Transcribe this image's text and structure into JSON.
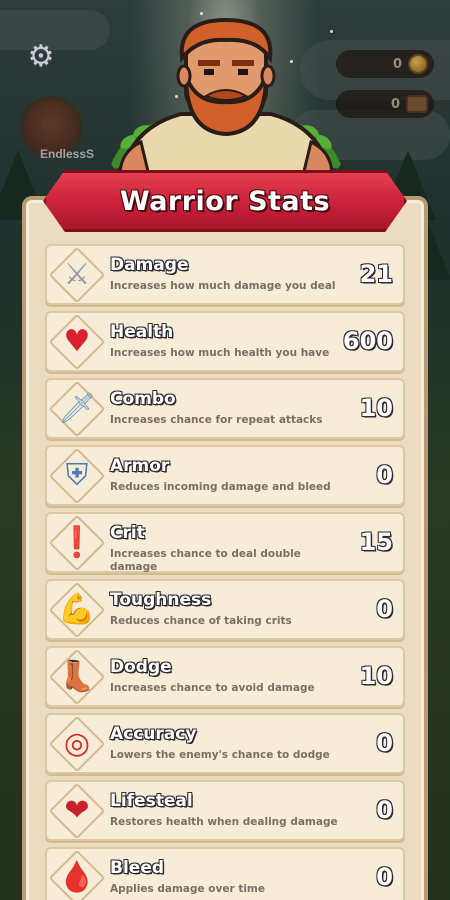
{
  "hud": {
    "player_name": "EndlessS",
    "gold_amount": "0",
    "gems_amount": "0",
    "settings_icon": "gear-icon"
  },
  "panel": {
    "title": "Warrior Stats"
  },
  "stats": [
    {
      "name": "Damage",
      "description": "Increases how much damage you deal",
      "value": "21",
      "icon": "crossed-swords-icon",
      "glyph": "⚔",
      "color": "#8d9aa6"
    },
    {
      "name": "Health",
      "description": "Increases how much health you have",
      "value": "600",
      "icon": "heart-icon",
      "glyph": "♥",
      "color": "#d8202e"
    },
    {
      "name": "Combo",
      "description": "Increases chance for repeat attacks",
      "value": "10",
      "icon": "sword-icon",
      "glyph": "🗡",
      "color": "#6f9cc0"
    },
    {
      "name": "Armor",
      "description": "Reduces incoming damage and bleed",
      "value": "0",
      "icon": "shield-icon",
      "glyph": "⛨",
      "color": "#4a78b8"
    },
    {
      "name": "Crit",
      "description": "Increases chance to deal double damage",
      "value": "15",
      "icon": "exclamation-burst-icon",
      "glyph": "❗",
      "color": "#e0402a"
    },
    {
      "name": "Toughness",
      "description": "Reduces chance of taking crits",
      "value": "0",
      "icon": "flexed-arm-icon",
      "glyph": "💪",
      "color": "#e59a2c"
    },
    {
      "name": "Dodge",
      "description": "Increases chance to avoid damage",
      "value": "10",
      "icon": "boot-icon",
      "glyph": "👢",
      "color": "#b8652e"
    },
    {
      "name": "Accuracy",
      "description": "Lowers the enemy's chance to dodge",
      "value": "0",
      "icon": "target-icon",
      "glyph": "◎",
      "color": "#d62a2a"
    },
    {
      "name": "Lifesteal",
      "description": "Restores health when dealing damage",
      "value": "0",
      "icon": "heart-dagger-icon",
      "glyph": "❤",
      "color": "#c8202c"
    },
    {
      "name": "Bleed",
      "description": "Applies damage over time",
      "value": "0",
      "icon": "blood-drop-icon",
      "glyph": "🩸",
      "color": "#c01a24"
    }
  ]
}
